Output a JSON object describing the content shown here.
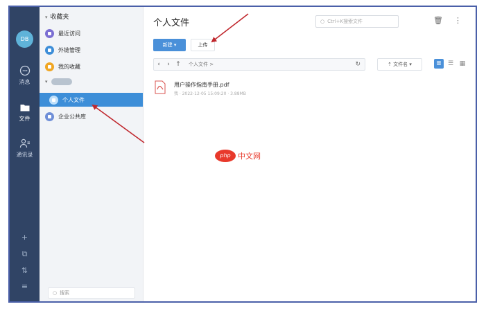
{
  "rail": {
    "avatar_text": "DB",
    "items": [
      {
        "label": "消息",
        "icon": "chat-icon"
      },
      {
        "label": "文件",
        "icon": "folder-icon"
      },
      {
        "label": "通讯录",
        "icon": "contacts-icon"
      }
    ],
    "bottom_icons": [
      "plus-icon",
      "stack-icon",
      "transfer-icon",
      "menu-icon"
    ]
  },
  "panel": {
    "favorites_header": "收藏夹",
    "favorites": [
      {
        "label": "最近访问",
        "color": "#7b6fd3"
      },
      {
        "label": "外链管理",
        "color": "#3d8ed8"
      },
      {
        "label": "我的收藏",
        "color": "#f0a623"
      }
    ],
    "library_items": [
      {
        "label": "个人文件",
        "selected": true,
        "color": "#ffffff"
      },
      {
        "label": "企业公共库",
        "selected": false,
        "color": "#6f8fd8"
      }
    ],
    "search_placeholder": "搜索"
  },
  "main": {
    "title": "个人文件",
    "search_placeholder": "Ctrl+K搜索文件",
    "new_button": "新建 ▾",
    "upload_button": "上传",
    "breadcrumb": "个人文件 >",
    "sort_label": "⇡ 文件名 ▾",
    "files": [
      {
        "name": "用户操作指南手册.pdf",
        "meta": "我 · 2022-12-05 15:09:20 · 3.88MB"
      }
    ]
  },
  "watermark": {
    "badge": "php",
    "text": "中文网"
  },
  "colors": {
    "accent": "#3d8ed8",
    "rail": "#304465",
    "arrow": "#c0272d"
  }
}
